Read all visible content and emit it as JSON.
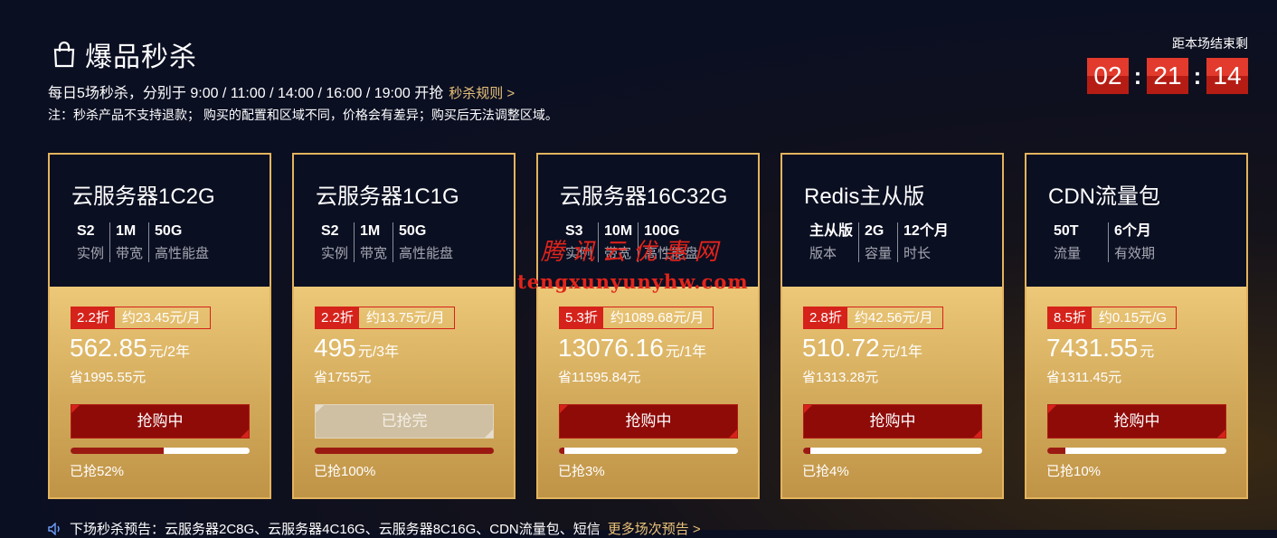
{
  "header": {
    "title": "爆品秒杀",
    "schedule": "每日5场秒杀，分别于 9:00 / 11:00 / 14:00 / 16:00 / 19:00 开抢",
    "rules_link": "秒杀规则 >",
    "note": "注：秒杀产品不支持退款； 购买的配置和区域不同，价格会有差异；购买后无法调整区域。"
  },
  "countdown": {
    "label": "距本场结束剩",
    "hours": "02",
    "minutes": "21",
    "seconds": "14"
  },
  "products": [
    {
      "name": "云服务器1C2G",
      "specs": [
        {
          "v": "S2",
          "l": "实例"
        },
        {
          "v": "1M",
          "l": "带宽"
        },
        {
          "v": "50G",
          "l": "高性能盘"
        }
      ],
      "discount": "2.2折",
      "per": "约23.45元/月",
      "price": "562.85",
      "unit": "元/2年",
      "save": "省1995.55元",
      "button": "抢购中",
      "soldout": false,
      "progress": 0.52,
      "sold_text": "已抢52%"
    },
    {
      "name": "云服务器1C1G",
      "specs": [
        {
          "v": "S2",
          "l": "实例"
        },
        {
          "v": "1M",
          "l": "带宽"
        },
        {
          "v": "50G",
          "l": "高性能盘"
        }
      ],
      "discount": "2.2折",
      "per": "约13.75元/月",
      "price": "495",
      "unit": "元/3年",
      "save": "省1755元",
      "button": "已抢完",
      "soldout": true,
      "progress": 1.0,
      "sold_text": "已抢100%"
    },
    {
      "name": "云服务器16C32G",
      "specs": [
        {
          "v": "S3",
          "l": "实例"
        },
        {
          "v": "10M",
          "l": "带宽"
        },
        {
          "v": "100G",
          "l": "高性能盘"
        }
      ],
      "discount": "5.3折",
      "per": "约1089.68元/月",
      "price": "13076.16",
      "unit": "元/1年",
      "save": "省11595.84元",
      "button": "抢购中",
      "soldout": false,
      "progress": 0.03,
      "sold_text": "已抢3%"
    },
    {
      "name": "Redis主从版",
      "specs": [
        {
          "v": "主从版",
          "l": "版本"
        },
        {
          "v": "2G",
          "l": "容量"
        },
        {
          "v": "12个月",
          "l": "时长"
        }
      ],
      "discount": "2.8折",
      "per": "约42.56元/月",
      "price": "510.72",
      "unit": "元/1年",
      "save": "省1313.28元",
      "button": "抢购中",
      "soldout": false,
      "progress": 0.04,
      "sold_text": "已抢4%"
    },
    {
      "name": "CDN流量包",
      "specs": [
        {
          "v": "50T",
          "l": "流量"
        },
        {
          "v": "6个月",
          "l": "有效期"
        }
      ],
      "discount": "8.5折",
      "per": "约0.15元/G",
      "price": "7431.55",
      "unit": "元",
      "save": "省1311.45元",
      "button": "抢购中",
      "soldout": false,
      "progress": 0.1,
      "sold_text": "已抢10%"
    }
  ],
  "watermark": {
    "cn": "腾讯云优惠网",
    "en": "tengxunyunyhw.com"
  },
  "ticker": {
    "text": "下场秒杀预告：云服务器2C8G、云服务器4C16G、云服务器8C16G、CDN流量包、短信",
    "more": "更多场次预告 >"
  }
}
